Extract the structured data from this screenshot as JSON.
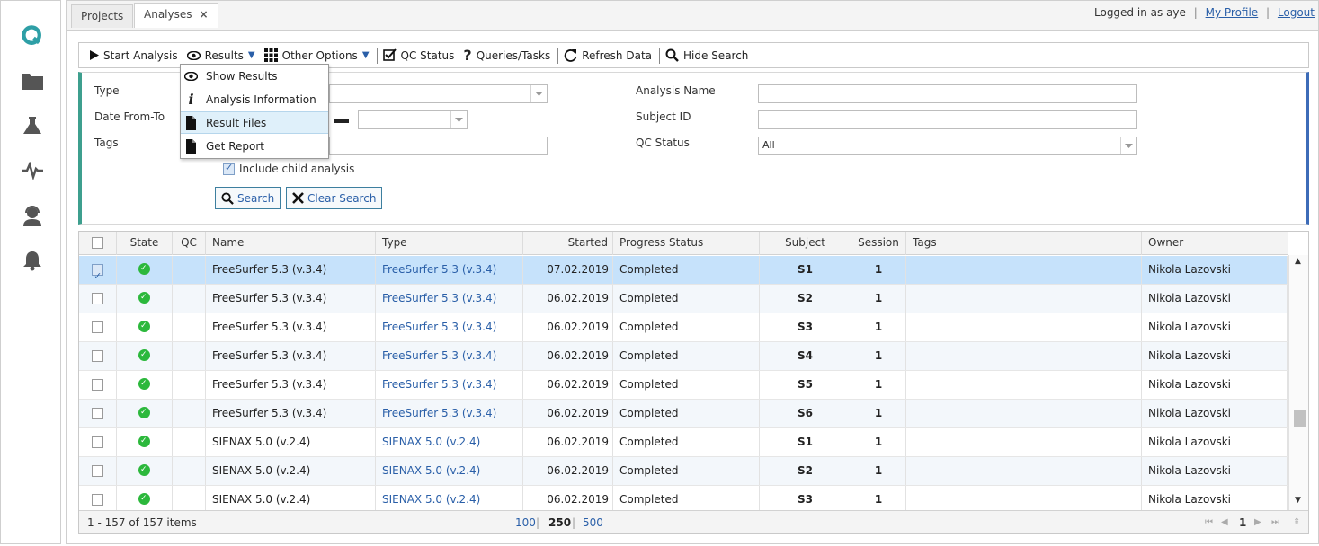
{
  "tabs": [
    {
      "label": "Projects"
    },
    {
      "label": "Analyses",
      "close": "×"
    }
  ],
  "user": {
    "logged_in_label": "Logged in as",
    "username": "aye",
    "profile_link": "My Profile",
    "logout_link": "Logout"
  },
  "toolbar": {
    "start_analysis": "Start Analysis",
    "results": "Results",
    "other_options": "Other Options",
    "qc_status": "QC Status",
    "queries_tasks": "Queries/Tasks",
    "refresh_data": "Refresh Data",
    "hide_search": "Hide Search"
  },
  "results_menu": {
    "items": [
      {
        "label": "Show Results",
        "icon": "eye-icon"
      },
      {
        "label": "Analysis Information",
        "icon": "info-icon"
      },
      {
        "label": "Result Files",
        "icon": "file-icon"
      },
      {
        "label": "Get Report",
        "icon": "file-icon"
      }
    ],
    "highlighted": "Result Files"
  },
  "search": {
    "type_label": "Type",
    "date_label": "Date From-To",
    "tags_label": "Tags",
    "include_child_label": "Include child analysis",
    "include_child_checked": true,
    "analysis_name_label": "Analysis Name",
    "subject_id_label": "Subject ID",
    "qc_status_label": "QC Status",
    "qc_status_value": "All",
    "search_button": "Search",
    "clear_button": "Clear Search"
  },
  "grid": {
    "columns": [
      "State",
      "QC",
      "Name",
      "Type",
      "Started",
      "Progress Status",
      "Subject",
      "Session",
      "Tags",
      "Owner"
    ],
    "rows": [
      {
        "selected": true,
        "name": "FreeSurfer 5.3 (v.3.4)",
        "type": "FreeSurfer 5.3 (v.3.4)",
        "started": "07.02.2019",
        "progress": "Completed",
        "subject": "S1",
        "session": "1",
        "tags": "",
        "owner": "Nikola Lazovski"
      },
      {
        "selected": false,
        "name": "FreeSurfer 5.3 (v.3.4)",
        "type": "FreeSurfer 5.3 (v.3.4)",
        "started": "06.02.2019",
        "progress": "Completed",
        "subject": "S2",
        "session": "1",
        "tags": "",
        "owner": "Nikola Lazovski"
      },
      {
        "selected": false,
        "name": "FreeSurfer 5.3 (v.3.4)",
        "type": "FreeSurfer 5.3 (v.3.4)",
        "started": "06.02.2019",
        "progress": "Completed",
        "subject": "S3",
        "session": "1",
        "tags": "",
        "owner": "Nikola Lazovski"
      },
      {
        "selected": false,
        "name": "FreeSurfer 5.3 (v.3.4)",
        "type": "FreeSurfer 5.3 (v.3.4)",
        "started": "06.02.2019",
        "progress": "Completed",
        "subject": "S4",
        "session": "1",
        "tags": "",
        "owner": "Nikola Lazovski"
      },
      {
        "selected": false,
        "name": "FreeSurfer 5.3 (v.3.4)",
        "type": "FreeSurfer 5.3 (v.3.4)",
        "started": "06.02.2019",
        "progress": "Completed",
        "subject": "S5",
        "session": "1",
        "tags": "",
        "owner": "Nikola Lazovski"
      },
      {
        "selected": false,
        "name": "FreeSurfer 5.3 (v.3.4)",
        "type": "FreeSurfer 5.3 (v.3.4)",
        "started": "06.02.2019",
        "progress": "Completed",
        "subject": "S6",
        "session": "1",
        "tags": "",
        "owner": "Nikola Lazovski"
      },
      {
        "selected": false,
        "name": "SIENAX 5.0 (v.2.4)",
        "type": "SIENAX 5.0 (v.2.4)",
        "started": "06.02.2019",
        "progress": "Completed",
        "subject": "S1",
        "session": "1",
        "tags": "",
        "owner": "Nikola Lazovski"
      },
      {
        "selected": false,
        "name": "SIENAX 5.0 (v.2.4)",
        "type": "SIENAX 5.0 (v.2.4)",
        "started": "06.02.2019",
        "progress": "Completed",
        "subject": "S2",
        "session": "1",
        "tags": "",
        "owner": "Nikola Lazovski"
      },
      {
        "selected": false,
        "name": "SIENAX 5.0 (v.2.4)",
        "type": "SIENAX 5.0 (v.2.4)",
        "started": "06.02.2019",
        "progress": "Completed",
        "subject": "S3",
        "session": "1",
        "tags": "",
        "owner": "Nikola Lazovski"
      }
    ]
  },
  "pager": {
    "summary": "1 - 157 of 157 items",
    "sizes": [
      "100",
      "250",
      "500"
    ],
    "current_size": "250",
    "current_page": "1"
  },
  "colors": {
    "accent_blue": "#2a5fa8",
    "state_ok": "#2cb83c",
    "selected_row": "#c6e2fb",
    "search_left_border": "#3d9f8e",
    "search_right_border": "#3d6cb8"
  }
}
